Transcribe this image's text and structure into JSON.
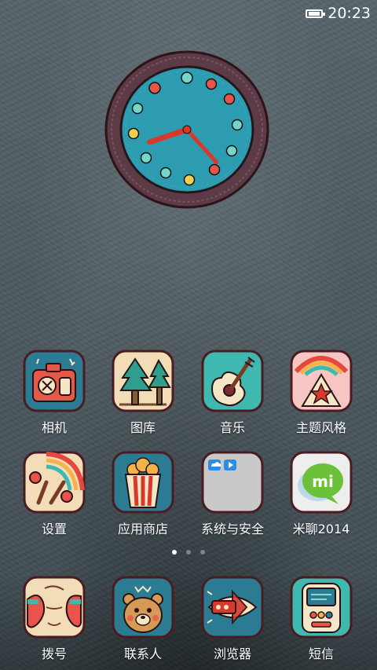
{
  "status_bar": {
    "time": "20:23",
    "battery_icon": "battery-icon"
  },
  "clock_widget": {
    "hour": 20,
    "minute": 23
  },
  "apps": [
    {
      "label": "相机",
      "icon": "camera-icon"
    },
    {
      "label": "图库",
      "icon": "gallery-icon"
    },
    {
      "label": "音乐",
      "icon": "music-icon"
    },
    {
      "label": "主题风格",
      "icon": "theme-icon"
    },
    {
      "label": "设置",
      "icon": "settings-icon"
    },
    {
      "label": "应用商店",
      "icon": "app-store-icon"
    },
    {
      "label": "系统与安全",
      "icon": "system-security-folder-icon"
    },
    {
      "label": "米聊2014",
      "icon": "miliao-icon"
    }
  ],
  "page_indicator": {
    "pages": 3,
    "current": 1
  },
  "dock": [
    {
      "label": "拨号",
      "icon": "dialer-icon"
    },
    {
      "label": "联系人",
      "icon": "contacts-icon"
    },
    {
      "label": "浏览器",
      "icon": "browser-icon"
    },
    {
      "label": "短信",
      "icon": "messages-icon"
    }
  ],
  "colors": {
    "wallpaper": "#4b5a60",
    "outline": "#5a1d23",
    "accent_red": "#d8392b",
    "accent_teal": "#2fa0b0"
  }
}
